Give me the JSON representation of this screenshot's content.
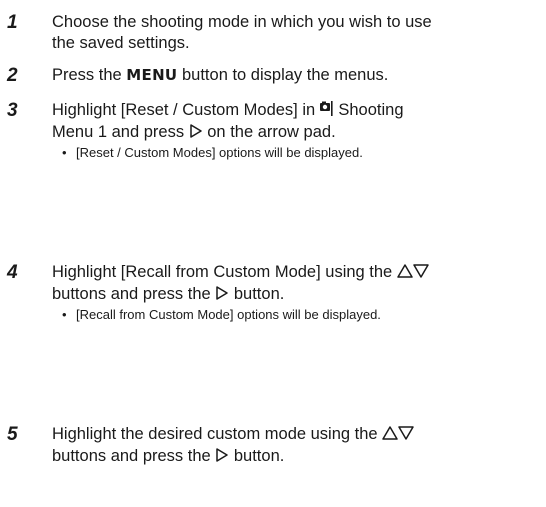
{
  "steps": [
    {
      "num": "1",
      "line1": "Choose the shooting mode in which you wish to use",
      "line2": "the saved settings."
    },
    {
      "num": "2",
      "before": "Press the ",
      "menu": "MENU",
      "after": " button to display the menus."
    },
    {
      "num": "3",
      "l1_before": "Highlight [Reset / Custom Modes] in ",
      "l1_after": " Shooting",
      "l2_before": "Menu 1 and press ",
      "l2_after": " on the arrow pad.",
      "bullet": "[Reset / Custom Modes] options will be displayed."
    },
    {
      "num": "4",
      "l1": "Highlight [Recall from Custom Mode] using the ",
      "l2_before": "buttons and press the ",
      "l2_after": " button.",
      "bullet": "[Recall from Custom Mode] options will be displayed."
    },
    {
      "num": "5",
      "l1": "Highlight the desired custom mode using the ",
      "l2_before": "buttons and press the ",
      "l2_after": " button."
    }
  ],
  "bullet_symbol": "•",
  "icons": {
    "up": "up-arrow-icon",
    "down": "down-arrow-icon",
    "right": "right-arrow-icon",
    "camera": "camera-shooting-menu-icon"
  }
}
